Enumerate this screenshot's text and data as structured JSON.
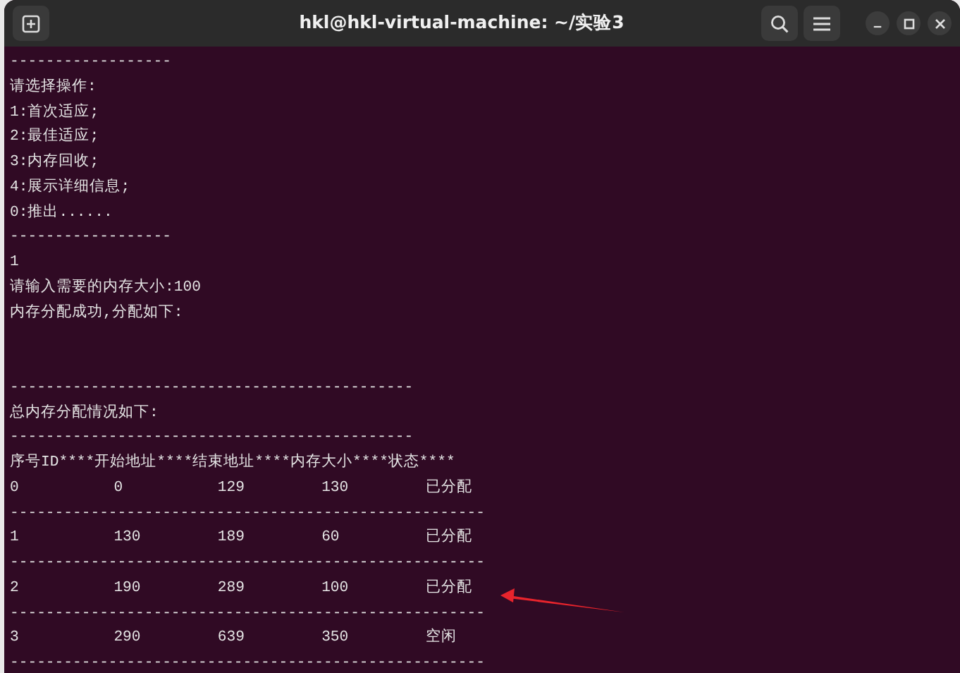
{
  "window": {
    "title": "hkl@hkl-virtual-machine: ~/实验3"
  },
  "terminal": {
    "lines": [
      {
        "kind": "text",
        "text": "------------------"
      },
      {
        "kind": "text",
        "text": "请选择操作:"
      },
      {
        "kind": "text",
        "text": "1:首次适应;"
      },
      {
        "kind": "text",
        "text": "2:最佳适应;"
      },
      {
        "kind": "text",
        "text": "3:内存回收;"
      },
      {
        "kind": "text",
        "text": "4:展示详细信息;"
      },
      {
        "kind": "text",
        "text": "0:推出......"
      },
      {
        "kind": "text",
        "text": "------------------"
      },
      {
        "kind": "text",
        "text": "1"
      },
      {
        "kind": "text",
        "text": "请输入需要的内存大小:100"
      },
      {
        "kind": "text",
        "text": "内存分配成功,分配如下:"
      },
      {
        "kind": "blank"
      },
      {
        "kind": "blank"
      },
      {
        "kind": "text",
        "text": "---------------------------------------------"
      },
      {
        "kind": "text",
        "text": "总内存分配情况如下:"
      },
      {
        "kind": "text",
        "text": "---------------------------------------------"
      },
      {
        "kind": "text",
        "text": "序号ID****开始地址****结束地址****内存大小****状态****"
      },
      {
        "kind": "row",
        "cells": [
          "0",
          "0",
          "129",
          "130",
          "已分配"
        ]
      },
      {
        "kind": "text",
        "text": "-----------------------------------------------------"
      },
      {
        "kind": "row",
        "cells": [
          "1",
          "130",
          "189",
          "60",
          "已分配"
        ]
      },
      {
        "kind": "text",
        "text": "-----------------------------------------------------"
      },
      {
        "kind": "row",
        "cells": [
          "2",
          "190",
          "289",
          "100",
          "已分配"
        ]
      },
      {
        "kind": "text",
        "text": "-----------------------------------------------------"
      },
      {
        "kind": "row",
        "cells": [
          "3",
          "290",
          "639",
          "350",
          "空闲"
        ]
      },
      {
        "kind": "text",
        "text": "-----------------------------------------------------"
      }
    ]
  }
}
